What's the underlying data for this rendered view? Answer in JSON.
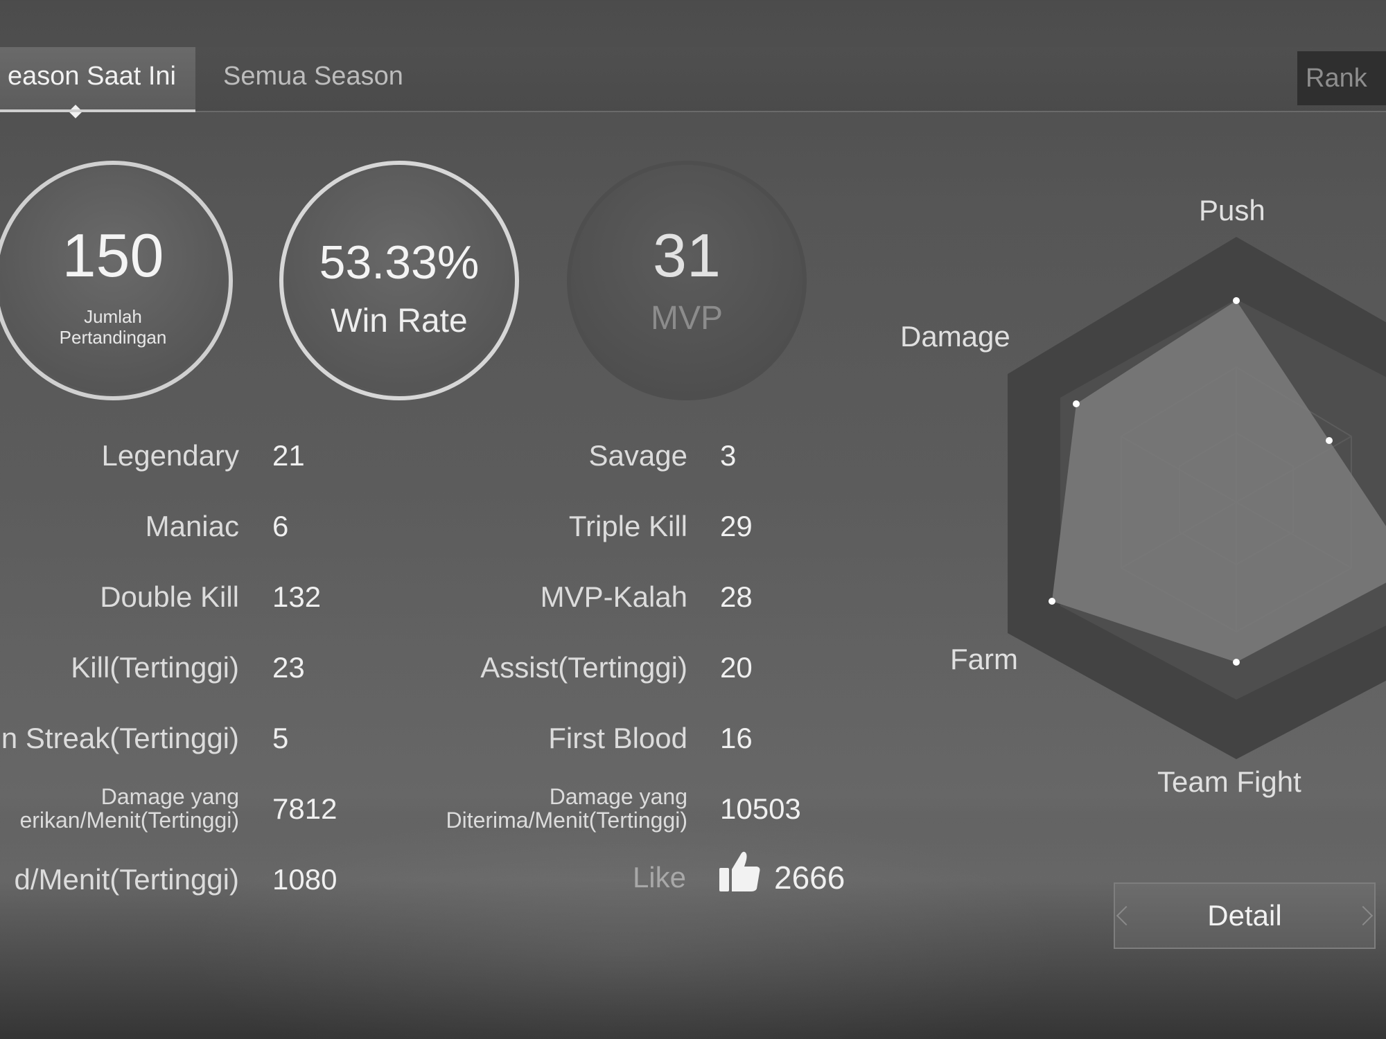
{
  "tabs": {
    "current_season": "eason Saat Ini",
    "all_seasons": "Semua Season",
    "rank": "Rank"
  },
  "summary": {
    "matches": {
      "value": "150",
      "label_line1": "Jumlah",
      "label_line2": "Pertandingan"
    },
    "win_rate": {
      "value": "53.33%",
      "label": "Win Rate"
    },
    "mvp": {
      "value": "31",
      "label": "MVP"
    }
  },
  "stats_left": [
    {
      "label": "Legendary",
      "value": "21"
    },
    {
      "label": "Maniac",
      "value": "6"
    },
    {
      "label": "Double Kill",
      "value": "132"
    },
    {
      "label": "Kill(Tertinggi)",
      "value": "23"
    },
    {
      "label": "/in Streak(Tertinggi)",
      "value": "5"
    },
    {
      "label_line1": "Damage yang",
      "label_line2": "erikan/Menit(Tertinggi)",
      "value": "7812"
    },
    {
      "label": "d/Menit(Tertinggi)",
      "value": "1080"
    }
  ],
  "stats_right": [
    {
      "label": "Savage",
      "value": "3"
    },
    {
      "label": "Triple Kill",
      "value": "29"
    },
    {
      "label": "MVP-Kalah",
      "value": "28"
    },
    {
      "label": "Assist(Tertinggi)",
      "value": "20"
    },
    {
      "label": "First Blood",
      "value": "16"
    },
    {
      "label_line1": "Damage yang",
      "label_line2": "Diterima/Menit(Tertinggi)",
      "value": "10503"
    },
    {
      "label": "Like",
      "value": "2666",
      "icon": "thumbs-up-icon"
    }
  ],
  "radar": {
    "axes": [
      "Push",
      "Damage",
      "Farm",
      "Team Fight"
    ],
    "detail_button": "Detail"
  }
}
